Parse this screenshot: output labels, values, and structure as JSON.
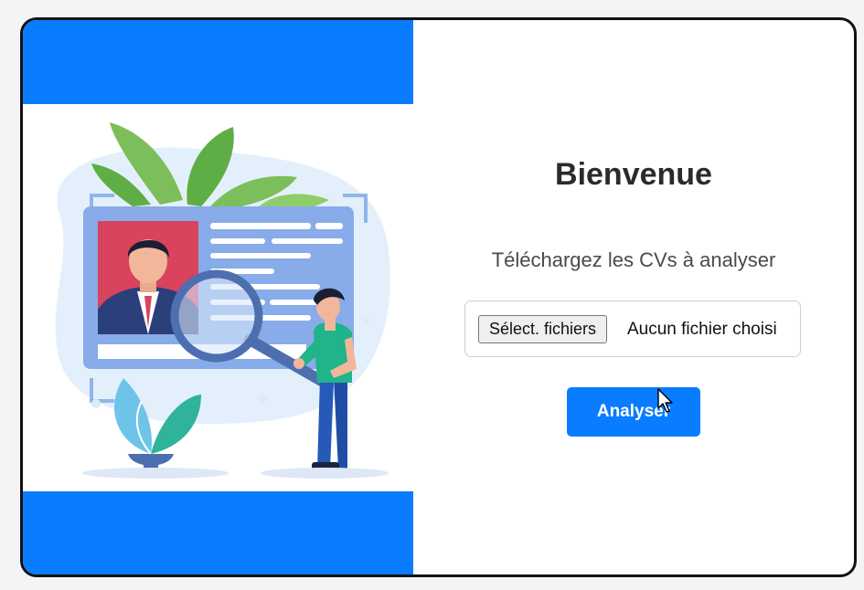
{
  "welcome": {
    "title": "Bienvenue",
    "subtitle": "Téléchargez les CVs à analyser"
  },
  "upload": {
    "button_label": "Sélect. fichiers",
    "status_text": "Aucun fichier choisi"
  },
  "actions": {
    "analyze_label": "Analyser"
  },
  "colors": {
    "accent": "#0a7cff",
    "card_border": "#111111",
    "title_text": "#2b2b2b"
  },
  "icons": {
    "cursor": "mouse-pointer-icon",
    "illustration": "resume-search-illustration"
  }
}
